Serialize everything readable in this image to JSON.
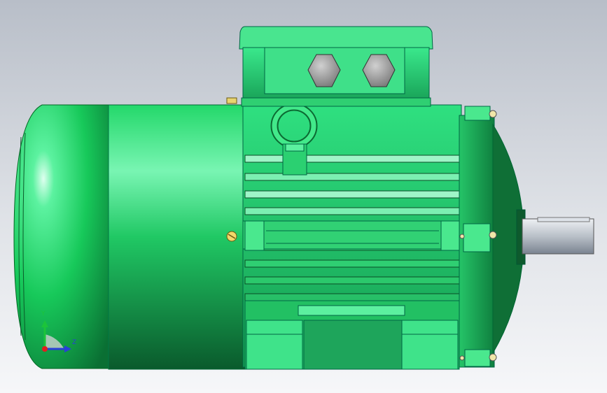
{
  "viewport": {
    "model_color": "#1fe06a",
    "background_top": "#b8bec8",
    "background_bottom": "#f6f7f9",
    "shaft_color": "#c9cfd6"
  },
  "triad": {
    "y_label": "Y",
    "z_label": "Z",
    "y_color": "#1cc43a",
    "z_color": "#2a3fd8",
    "x_color": "#e02020"
  }
}
